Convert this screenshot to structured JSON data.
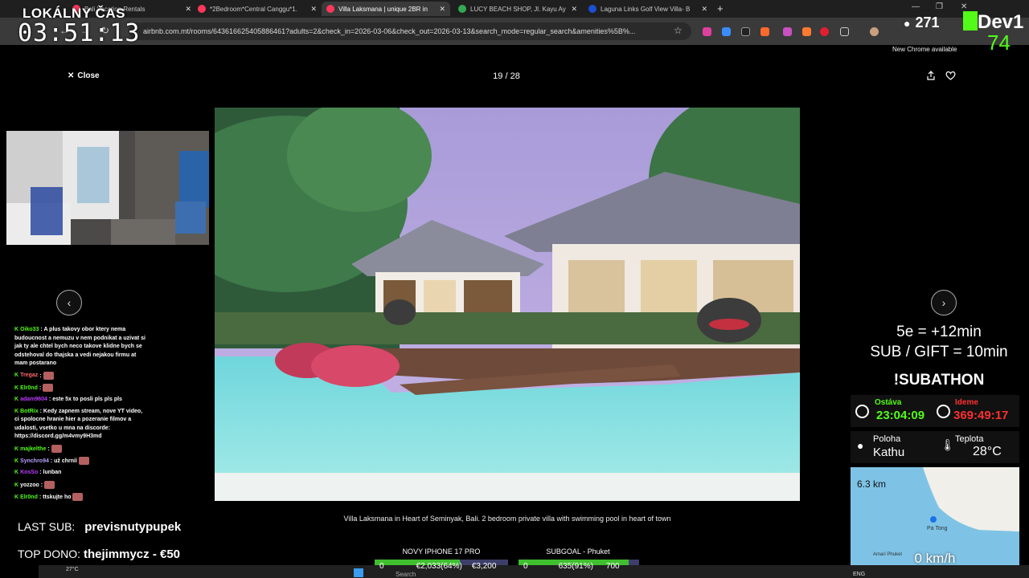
{
  "browser": {
    "tabs": [
      {
        "title": "Bali Vacation Rentals",
        "color": "#ff385c",
        "active": false
      },
      {
        "title": "*2Bedroom*Central Canggu*1.",
        "color": "#ff385c",
        "active": false
      },
      {
        "title": "Villa Laksmana | unique 2BR in",
        "color": "#ff385c",
        "active": true
      },
      {
        "title": "LUCY BEACH SHOP, Jl. Kayu Ay",
        "color": "#34a853",
        "active": false
      },
      {
        "title": "Laguna Links Golf View Villa- B",
        "color": "#1a4fd6",
        "active": false
      }
    ],
    "url": "airbnb.com.mt/rooms/643616625405886461?adults=2&check_in=2026-03-06&check_out=2026-03-13&search_mode=regular_search&amenities%5B%...",
    "new_chrome": "New Chrome available"
  },
  "stream": {
    "clock_label": "LOKÁLNY ČAS",
    "clock": "03:51:13",
    "viewers": "271",
    "channel_brand": "Dev1",
    "channel_num": "74"
  },
  "viewer": {
    "close_label": "Close",
    "counter": "19 / 28",
    "caption": "Villa Laksmana in Heart of Seminyak, Bali. 2 bedroom private villa with swimming pool in heart of town"
  },
  "chat": [
    {
      "user": "Oiko33",
      "user_color": "#53fc18",
      "text": ": A plus takovy obor ktery nema budoucnost a nemuzu v nem podnikat a uzivat si jak ty ale chtel bych neco takove klidne bych se odstehoval do thajska a vedi nejakou firmu at mam postarano",
      "emote": false
    },
    {
      "user": "Tregaz",
      "user_color": "#ff6b6b",
      "text": ":",
      "emote": true
    },
    {
      "user": "Elr0nd",
      "user_color": "#53fc18",
      "text": ":",
      "emote": true
    },
    {
      "user": "adam9604",
      "user_color": "#b93bff",
      "text": ": este 5x to posli pls pls pls",
      "emote": false
    },
    {
      "user": "BotRix",
      "user_color": "#53fc18",
      "text": ": Kedy zapnem stream, nove YT video, ci spolocne hranie hier a pozeranie filmov a udalosti, vsetko u mna na discorde: https://discord.gg/m4vmy9H3md",
      "emote": false
    },
    {
      "user": "majkelthe",
      "user_color": "#53fc18",
      "text": ":",
      "emote": true
    },
    {
      "user": "Synchro94",
      "user_color": "#b9a0ff",
      "text": ": už chrníí",
      "emote": true
    },
    {
      "user": "KosSo",
      "user_color": "#b93bff",
      "text": ": lunban",
      "emote": false
    },
    {
      "user": "yozzoo",
      "user_color": "#ffffff",
      "text": ":",
      "emote": true
    },
    {
      "user": "Elr0nd",
      "user_color": "#53fc18",
      "text": ": ttskujte ho",
      "emote": true
    }
  ],
  "last_sub": {
    "label": "LAST SUB:",
    "value": "previsnutypupek"
  },
  "top_dono": {
    "label": "TOP DONO:",
    "value": "thejimmycz - €50"
  },
  "goals": [
    {
      "title": "NOVY IPHONE 17 PRO",
      "start": "0",
      "progress": "€2,033(64%)",
      "target": "€3,200",
      "fraction": 0.64
    },
    {
      "title": "SUBGOAL - Phuket",
      "start": "0",
      "progress": "635(91%)",
      "target": "700",
      "fraction": 0.91
    }
  ],
  "subathon": {
    "rate1": "5e = +12min",
    "rate2": "SUB / GIFT = 10min",
    "title": "!SUBATHON",
    "remain_label": "Ostáva",
    "remain_value": "23:04:09",
    "running_label": "Ideme",
    "running_value": "369:49:17"
  },
  "location": {
    "loc_label": "Poloha",
    "loc_value": "Kathu",
    "temp_label": "Teplota",
    "temp_value": "28°C",
    "map_distance": "6.3 km",
    "map_speed": "0 km/h",
    "map_places": [
      "Pa Tong",
      "Amari Phuket"
    ]
  },
  "taskbar": {
    "weather": "27°C",
    "search": "Search",
    "lang": "ENG"
  },
  "colors": {
    "kick_green": "#53fc18",
    "airbnb": "#ff385c",
    "alert_red": "#ff3030"
  }
}
